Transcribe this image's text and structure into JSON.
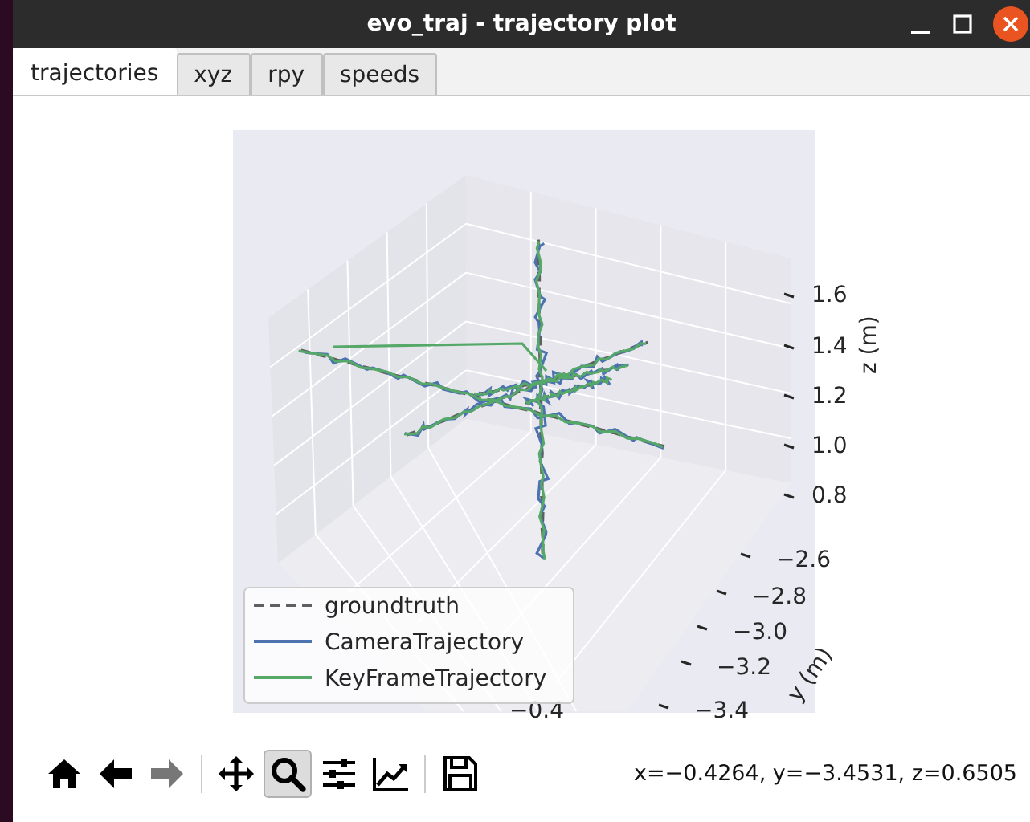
{
  "window": {
    "title": "evo_traj - trajectory plot"
  },
  "tabs": [
    {
      "label": "trajectories",
      "selected": true
    },
    {
      "label": "xyz",
      "selected": false
    },
    {
      "label": "rpy",
      "selected": false
    },
    {
      "label": "speeds",
      "selected": false
    }
  ],
  "plot": {
    "z_ticks": [
      "1.6",
      "1.4",
      "1.2",
      "1.0",
      "0.8"
    ],
    "z_label": "z (m)",
    "y_ticks": [
      "−2.6",
      "−2.8",
      "−3.0",
      "−3.2",
      "−3.4"
    ],
    "y_label": "y (m)",
    "x_ticks": [
      "−0.4"
    ],
    "legend": [
      {
        "label": "groundtruth",
        "color": "#5f5f5f",
        "kind": "dashed"
      },
      {
        "label": "CameraTrajectory",
        "color": "#4c72b0",
        "kind": "solid"
      },
      {
        "label": "KeyFrameTrajectory",
        "color": "#55a868",
        "kind": "solid"
      }
    ]
  },
  "toolbar": [
    {
      "kind": "home",
      "selected": false,
      "disabled": false
    },
    {
      "kind": "back",
      "selected": false,
      "disabled": false
    },
    {
      "kind": "forward",
      "selected": false,
      "disabled": true
    },
    {
      "kind": "separator"
    },
    {
      "kind": "pan",
      "selected": false,
      "disabled": false
    },
    {
      "kind": "zoom",
      "selected": true,
      "disabled": false
    },
    {
      "kind": "configure",
      "selected": false,
      "disabled": false
    },
    {
      "kind": "edit",
      "selected": false,
      "disabled": false
    },
    {
      "kind": "separator"
    },
    {
      "kind": "save",
      "selected": false,
      "disabled": false
    }
  ],
  "status": "x=−0.4264, y=−3.4531, z=0.6505"
}
